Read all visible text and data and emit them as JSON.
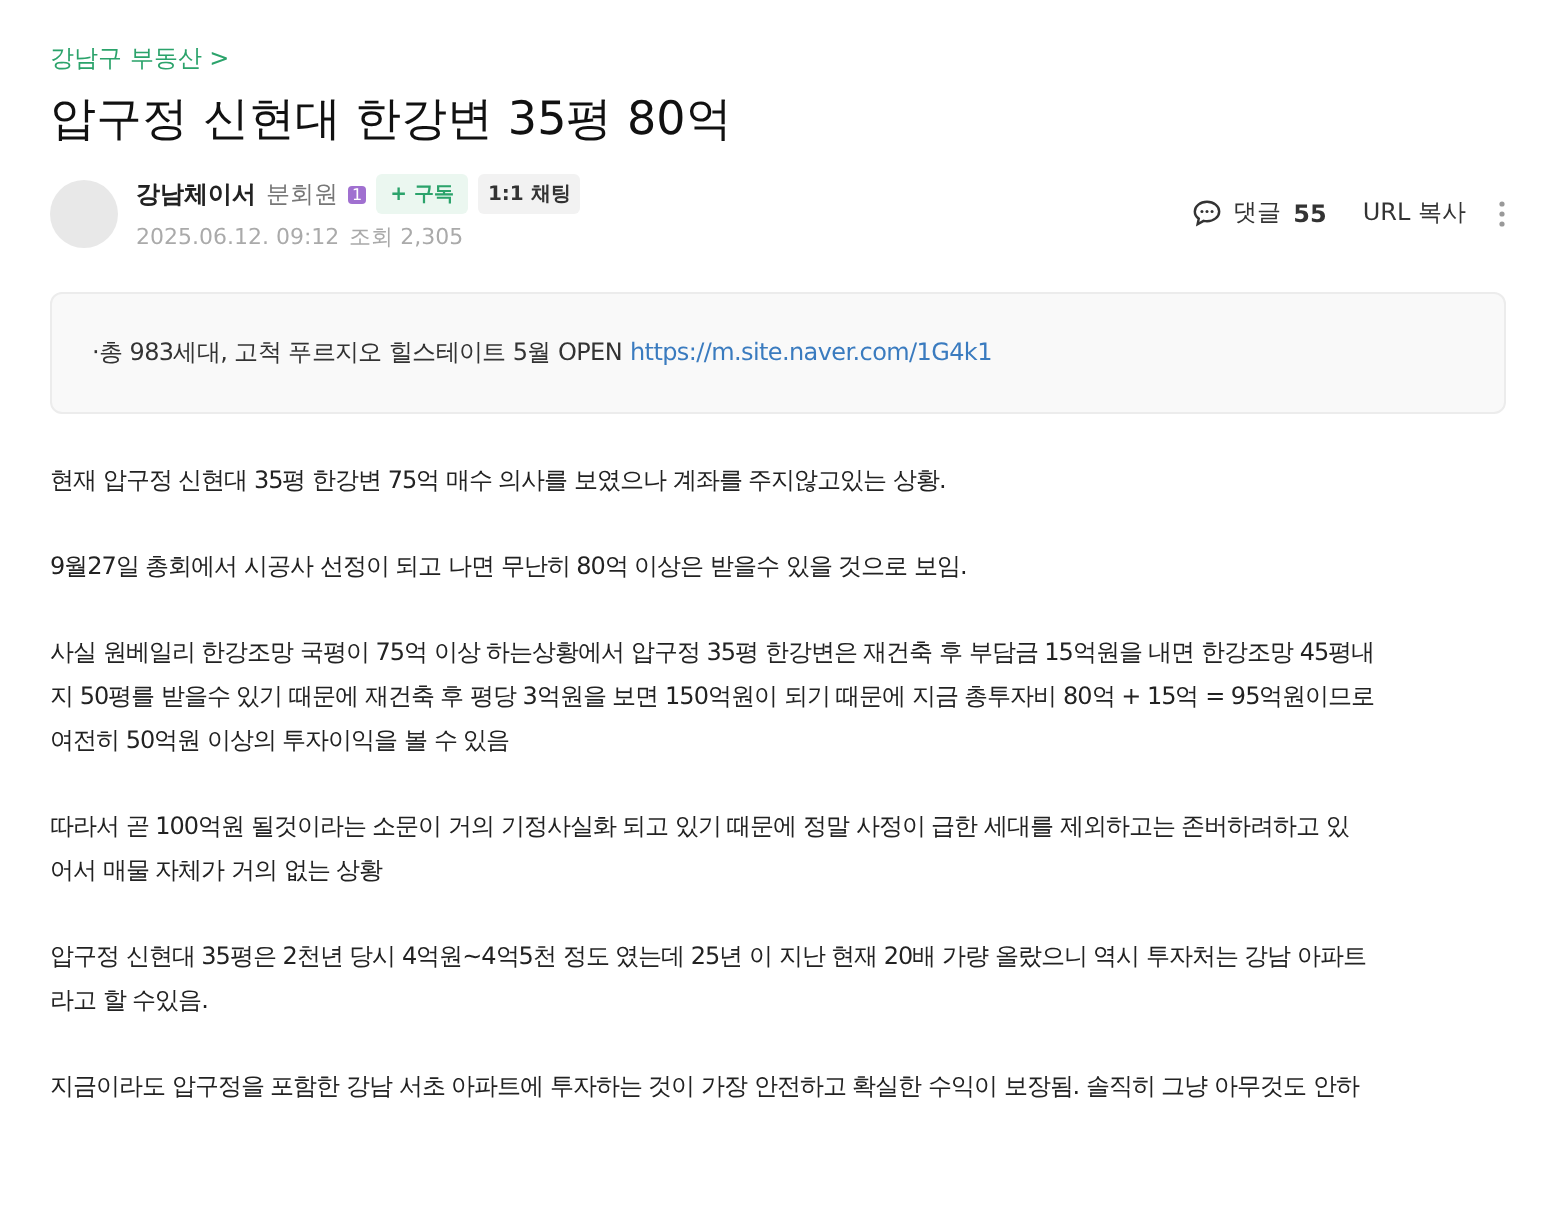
{
  "breadcrumb": "강남구 부동산 >",
  "title": "압구정 신현대 한강변 35평 80억",
  "author": {
    "name": "강남체이서",
    "grade": "분회원",
    "grade_badge": "1",
    "subscribe": "+ 구독",
    "chat": "1:1 채팅",
    "date": "2025.06.12. 09:12",
    "views": "조회 2,305"
  },
  "actions": {
    "comments_label": "댓글",
    "comments_count": "55",
    "copy_url": "URL 복사"
  },
  "notice": {
    "text": "·총 983세대, 고척 푸르지오 힐스테이트 5월 OPEN",
    "link": "https://m.site.naver.com/1G4k1"
  },
  "paragraphs": [
    "현재 압구정 신현대 35평 한강변 75억 매수 의사를 보였으나 계좌를 주지않고있는 상황.",
    "9월27일 총회에서 시공사 선정이 되고 나면 무난히 80억 이상은 받을수 있을 것으로 보임.",
    "사실 원베일리 한강조망 국평이 75억 이상 하는상황에서 압구정 35평 한강변은 재건축 후 부담금 15억원을 내면 한강조망 45평내\n지 50평를 받을수 있기 때문에 재건축 후 평당 3억원을 보면 150억원이 되기 때문에 지금 총투자비 80억 + 15억 = 95억원이므로\n여전히 50억원 이상의 투자이익을 볼 수 있음",
    "따라서 곧 100억원 될것이라는 소문이 거의 기정사실화  되고 있기 때문에 정말 사정이 급한 세대를 제외하고는 존버하려하고 있\n어서 매물 자체가 거의 없는 상황",
    "압구정 신현대 35평은 2천년 당시 4억원~4억5천 정도 였는데 25년 이 지난 현재 20배 가량 올랐으니 역시 투자처는 강남 아파트\n라고 할 수있음.",
    "지금이라도 압구정을 포함한 강남 서초 아파트에 투자하는 것이 가장 안전하고 확실한 수익이 보장됨. 솔직히 그냥 아무것도 안하"
  ]
}
